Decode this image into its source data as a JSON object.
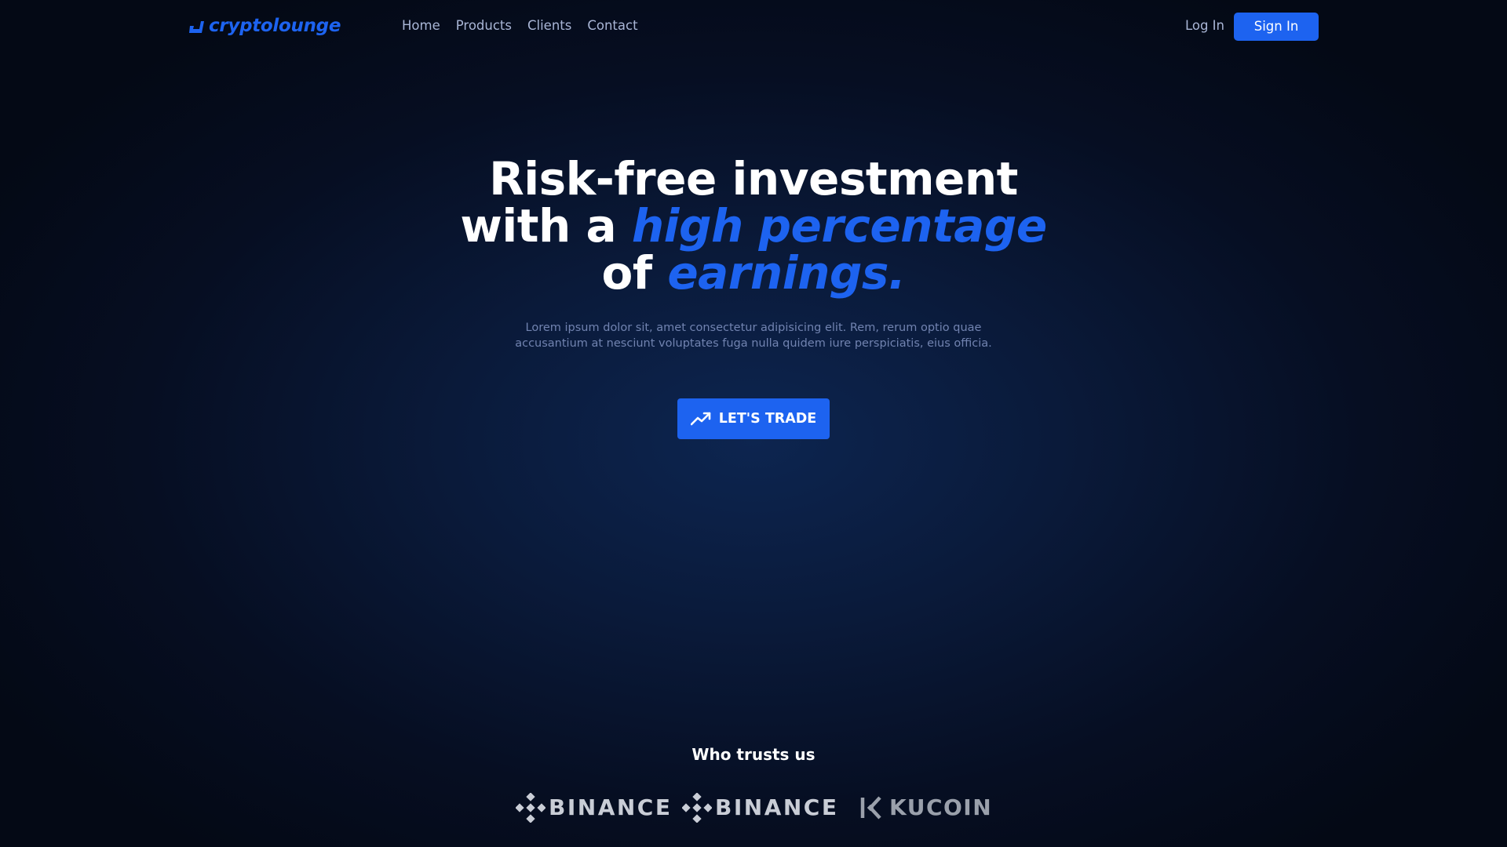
{
  "nav": {
    "logo_text": "cryptolounge",
    "links": [
      "Home",
      "Products",
      "Clients",
      "Contact"
    ],
    "login_label": "Log In",
    "signin_label": "Sign In"
  },
  "hero": {
    "title_line1": "Risk-free investment",
    "title_line2_prefix": "with a ",
    "title_line2_accent": "high percentage",
    "title_line3_prefix": "of ",
    "title_line3_accent": "earnings.",
    "subtitle": "Lorem ipsum dolor sit, amet consectetur adipisicing elit. Rem, rerum optio quae accusantium at nesciunt voluptates fuga nulla quidem iure perspiciatis, eius officia.",
    "cta_label": "LET'S TRADE",
    "cta_icon": "trending-up-icon"
  },
  "trusts": {
    "heading": "Who trusts us",
    "brands": [
      {
        "name": "BINANCE",
        "icon": "binance-icon"
      },
      {
        "name": "BINANCE",
        "icon": "binance-icon"
      },
      {
        "name": "KUCOIN",
        "icon": "kucoin-icon"
      }
    ]
  },
  "colors": {
    "accent": "#1d63f0",
    "background": "#060e22",
    "nav_text": "#a9b6d6",
    "subtitle_text": "#7183b0"
  }
}
